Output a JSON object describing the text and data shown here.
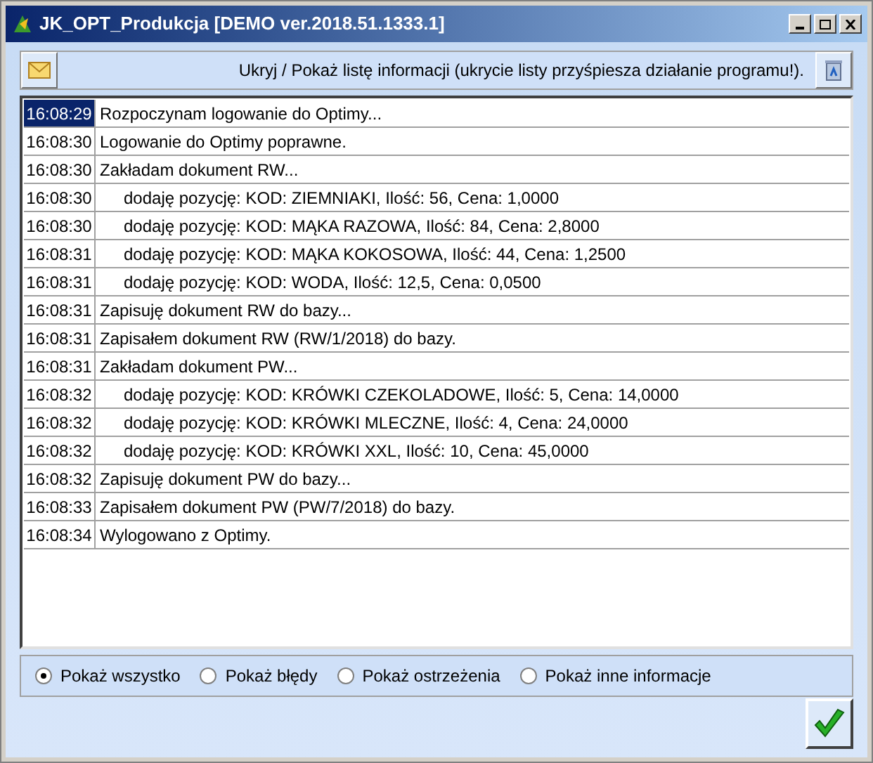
{
  "window": {
    "title": "JK_OPT_Produkcja [DEMO ver.2018.51.1333.1]"
  },
  "toolbar": {
    "label": "Ukryj / Pokaż listę informacji (ukrycie listy przyśpiesza działanie programu!)."
  },
  "log": [
    {
      "time": "16:08:29",
      "message": "Rozpoczynam logowanie do Optimy...",
      "selected": true
    },
    {
      "time": "16:08:30",
      "message": "Logowanie do Optimy poprawne.",
      "selected": false
    },
    {
      "time": "16:08:30",
      "message": "Zakładam dokument RW...",
      "selected": false,
      "children": [
        {
          "time": "16:08:30",
          "message": "dodaję pozycję: KOD: ZIEMNIAKI, Ilość: 56, Cena: 1,0000",
          "selected": false
        },
        {
          "time": "16:08:30",
          "message": "dodaję pozycję: KOD: MĄKA RAZOWA, Ilość: 84, Cena: 2,8000",
          "selected": false
        },
        {
          "time": "16:08:31",
          "message": "dodaję pozycję: KOD: MĄKA KOKOSOWA, Ilość: 44, Cena: 1,2500",
          "selected": false
        },
        {
          "time": "16:08:31",
          "message": "dodaję pozycję: KOD: WODA, Ilość: 12,5, Cena: 0,0500",
          "selected": false
        }
      ]
    },
    {
      "time": "16:08:31",
      "message": "Zapisuję dokument RW do bazy...",
      "selected": false
    },
    {
      "time": "16:08:31",
      "message": "Zapisałem dokument RW (RW/1/2018) do bazy.",
      "selected": false
    },
    {
      "time": "16:08:31",
      "message": "Zakładam dokument PW...",
      "selected": false,
      "children": [
        {
          "time": "16:08:32",
          "message": "dodaję pozycję: KOD: KRÓWKI CZEKOLADOWE, Ilość: 5, Cena: 14,0000",
          "selected": false
        },
        {
          "time": "16:08:32",
          "message": "dodaję pozycję: KOD: KRÓWKI MLECZNE, Ilość: 4, Cena: 24,0000",
          "selected": false
        },
        {
          "time": "16:08:32",
          "message": "dodaję pozycję: KOD: KRÓWKI XXL, Ilość: 10, Cena: 45,0000",
          "selected": false
        }
      ]
    },
    {
      "time": "16:08:32",
      "message": "Zapisuję dokument PW do bazy...",
      "selected": false
    },
    {
      "time": "16:08:33",
      "message": "Zapisałem dokument PW (PW/7/2018) do bazy.",
      "selected": false
    },
    {
      "time": "16:08:34",
      "message": "Wylogowano z Optimy.",
      "selected": false
    }
  ],
  "filters": [
    {
      "label": "Pokaż wszystko",
      "selected": true
    },
    {
      "label": "Pokaż błędy",
      "selected": false
    },
    {
      "label": "Pokaż ostrzeżenia",
      "selected": false
    },
    {
      "label": "Pokaż inne informacje",
      "selected": false
    }
  ]
}
